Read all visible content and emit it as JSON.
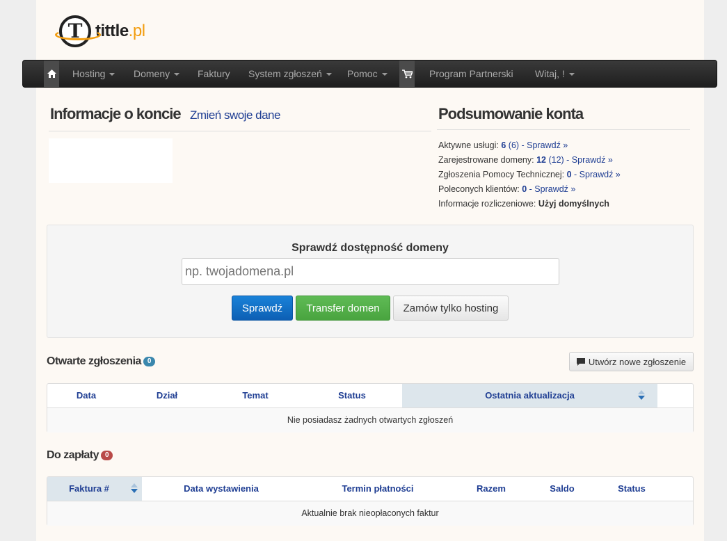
{
  "logo": {
    "name": "tittle",
    "tld": ".pl",
    "letter": "T"
  },
  "nav": {
    "items": [
      {
        "label": "Hosting",
        "dropdown": true
      },
      {
        "label": "Domeny",
        "dropdown": true
      },
      {
        "label": "Faktury",
        "dropdown": false
      },
      {
        "label": "System zgłoszeń",
        "dropdown": true
      },
      {
        "label": "Pomoc",
        "dropdown": true
      },
      {
        "label": "Program Partnerski",
        "dropdown": false
      },
      {
        "label": "Witaj, !",
        "dropdown": true
      }
    ],
    "home_icon": "home-icon",
    "cart_icon": "cart-icon"
  },
  "account": {
    "title": "Informacje o koncie",
    "edit_link": "Zmień swoje dane"
  },
  "summary": {
    "title": "Podsumowanie konta",
    "rows": [
      {
        "label": "Aktywne usługi:",
        "count": "6",
        "paren": "(6)",
        "link": "- Sprawdź »"
      },
      {
        "label": "Zarejestrowane domeny:",
        "count": "12",
        "paren": "(12)",
        "link": "- Sprawdź »"
      },
      {
        "label": "Zgłoszenia Pomocy Technicznej:",
        "count": "0",
        "link": "- Sprawdź »"
      },
      {
        "label": "Poleconych klientów:",
        "count": "0",
        "link": "- Sprawdź »"
      }
    ],
    "billing_label": "Informacje rozliczeniowe:",
    "billing_value": "Użyj domyślnych"
  },
  "domain_check": {
    "title": "Sprawdź dostępność domeny",
    "placeholder": "np. twojadomena.pl",
    "check_button": "Sprawdź",
    "transfer_button": "Transfer domen",
    "hosting_button": "Zamów tylko hosting"
  },
  "tickets": {
    "title": "Otwarte zgłoszenia",
    "count": "0",
    "new_button": "Utwórz nowe zgłoszenie",
    "columns": [
      "Data",
      "Dział",
      "Temat",
      "Status",
      "Ostatnia aktualizacja"
    ],
    "empty": "Nie posiadasz żadnych otwartych zgłoszeń"
  },
  "invoices": {
    "title": "Do zapłaty",
    "count": "0",
    "columns": [
      "Faktura #",
      "Data wystawienia",
      "Termin płatności",
      "Razem",
      "Saldo",
      "Status"
    ],
    "empty": "Aktualnie brak nieopłaconych faktur"
  },
  "colors": {
    "accent": "#f29d0f",
    "link": "#1f3e93",
    "primary_button": "#1a82d8",
    "success_button": "#5fbb55",
    "badge_blue": "#3a87ad",
    "badge_red": "#b94a48"
  }
}
